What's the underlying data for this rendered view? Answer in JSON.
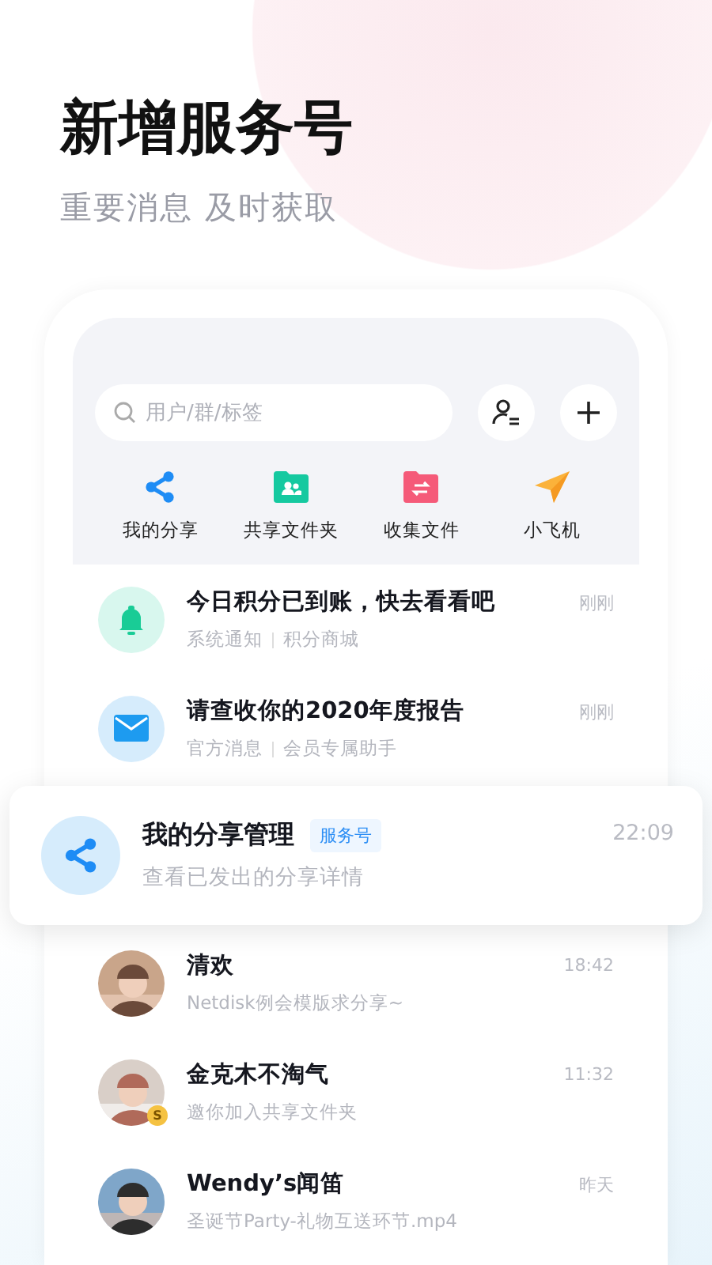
{
  "headline": {
    "title": "新增服务号",
    "subtitle": "重要消息 及时获取"
  },
  "search": {
    "placeholder": "用户/群/标签"
  },
  "shortcuts": [
    {
      "kind": "share",
      "label": "我的分享"
    },
    {
      "kind": "shared-folder",
      "label": "共享文件夹"
    },
    {
      "kind": "collect-folder",
      "label": "收集文件"
    },
    {
      "kind": "plane",
      "label": "小飞机"
    }
  ],
  "messages": [
    {
      "kind": "bell",
      "title": "今日积分已到账，快去看看吧",
      "subtitle_parts": [
        "系统通知",
        "积分商城"
      ],
      "time": "刚刚"
    },
    {
      "kind": "mail",
      "title": "请查收你的2020年度报告",
      "subtitle_parts": [
        "官方消息",
        "会员专属助手"
      ],
      "time": "刚刚"
    },
    {
      "kind": "featured",
      "title": "我的分享管理",
      "tag": "服务号",
      "subtitle_parts": [
        "查看已发出的分享详情"
      ],
      "time": "22:09"
    },
    {
      "title": "清欢",
      "subtitle_parts": [
        "Netdisk例会模版求分享~"
      ],
      "time": "18:42"
    },
    {
      "title": "金克木不淘气",
      "subtitle_parts": [
        "邀你加入共享文件夹"
      ],
      "time": "11:32",
      "badge": "S"
    },
    {
      "title": "Wendy’s闻笛",
      "subtitle_parts": [
        "圣诞节Party-礼物互送环节.mp4"
      ],
      "time": "昨天"
    }
  ]
}
